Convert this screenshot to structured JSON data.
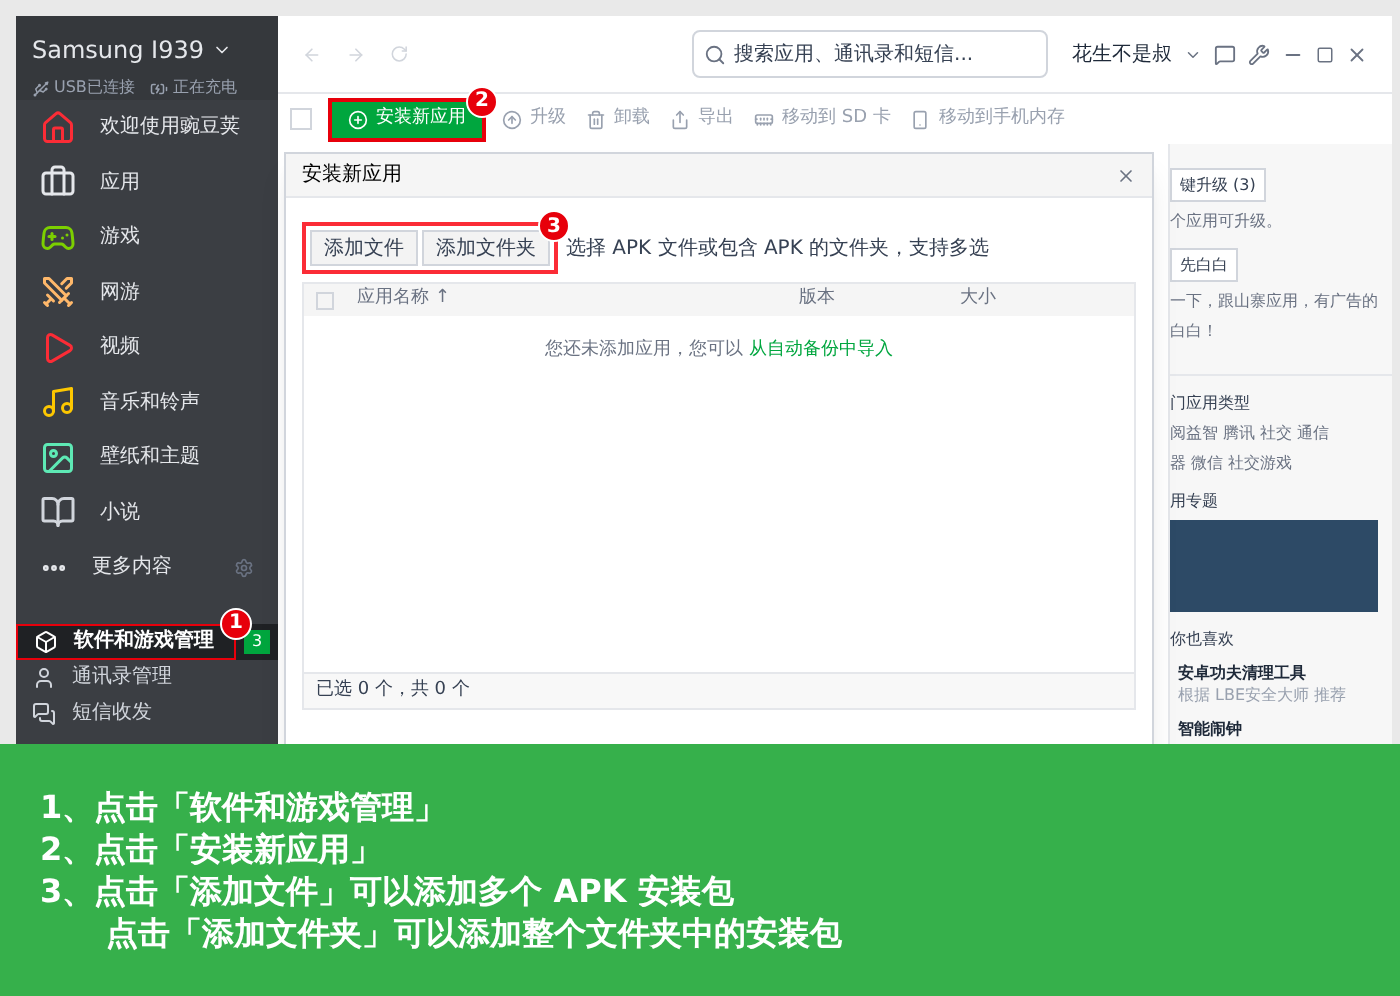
{
  "device": {
    "name": "Samsung I939",
    "status": [
      "USB已连接",
      "正在充电"
    ]
  },
  "nav": [
    {
      "label": "欢迎使用豌豆荚",
      "kind": "home"
    },
    {
      "label": "应用",
      "kind": "apps"
    },
    {
      "label": "游戏",
      "kind": "games"
    },
    {
      "label": "网游",
      "kind": "online"
    },
    {
      "label": "视频",
      "kind": "video"
    },
    {
      "label": "音乐和铃声",
      "kind": "music"
    },
    {
      "label": "壁纸和主题",
      "kind": "wallpaper"
    },
    {
      "label": "小说",
      "kind": "novel"
    },
    {
      "label": "更多内容",
      "kind": "more"
    }
  ],
  "manage": [
    {
      "label": "软件和游戏管理",
      "kind": "box",
      "selected": true,
      "badge": "3",
      "marker": "1"
    },
    {
      "label": "通讯录管理",
      "kind": "contacts",
      "selected": false
    },
    {
      "label": "短信收发",
      "kind": "sms",
      "selected": false
    }
  ],
  "topbar": {
    "search_placeholder": "搜索应用、通讯录和短信...",
    "user": "花生不是叔"
  },
  "select_all": {
    "checked": false
  },
  "toolbar": [
    {
      "label": "安装新应用",
      "kind": "install",
      "disabled": false,
      "marker": "2"
    },
    {
      "label": "升级",
      "kind": "upgrade",
      "disabled": true
    },
    {
      "label": "卸载",
      "kind": "uninstall",
      "disabled": true
    },
    {
      "label": "导出",
      "kind": "export",
      "disabled": true
    },
    {
      "label": "移动到 SD 卡",
      "kind": "sd",
      "disabled": true
    },
    {
      "label": "移动到手机内存",
      "kind": "phone",
      "disabled": true
    }
  ],
  "right_panel": {
    "upgrade_button": "键升级 (3)",
    "upgrade_note": "个应用可升级。",
    "clean_button": "先白白",
    "clean_note": [
      "一下，跟山寨应用，有广告的",
      "白白！"
    ],
    "types_title": "门应用类型",
    "type_lines": [
      "阅益智 腾讯 社交 通信",
      "器 微信 社交游戏"
    ],
    "topic_title": "用专题",
    "like_title": "你也喜欢",
    "likes": [
      {
        "name": "安卓功夫清理工具",
        "note": "根据 LBE安全大师 推荐"
      },
      {
        "name": "智能闹钟"
      }
    ]
  },
  "dialog": {
    "title": "安装新应用",
    "buttons": [
      "添加文件",
      "添加文件夹"
    ],
    "marker": "3",
    "header_checked": false,
    "hint": "选择 APK 文件或包含 APK 的文件夹，支持多选",
    "columns": [
      "应用名称 ↑",
      "版本",
      "大小"
    ],
    "empty_text": "您还未添加应用，您可以 ",
    "empty_link": "从自动备份中导入",
    "footer": "已选 0 个，共 0 个"
  },
  "caption": [
    "1、点击「软件和游戏管理」",
    "2、点击「安装新应用」",
    "3、点击「添加文件」可以添加多个 APK 安装包",
    "点击「添加文件夹」可以添加整个文件夹中的安装包"
  ]
}
